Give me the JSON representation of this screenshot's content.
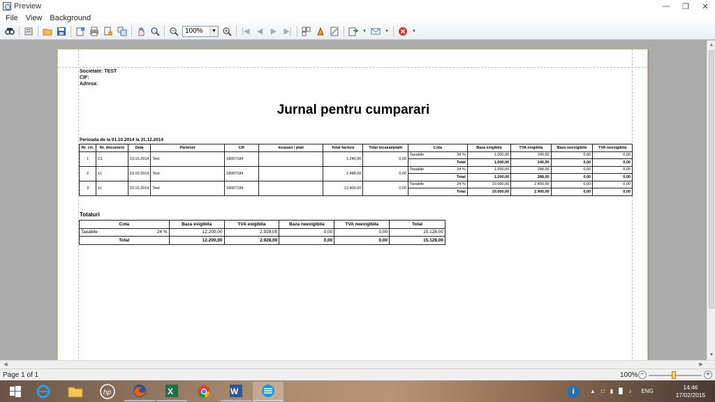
{
  "window": {
    "title": "Preview"
  },
  "menu": [
    "File",
    "View",
    "Background"
  ],
  "toolbar": {
    "zoom_value": "100%"
  },
  "report": {
    "societate": "Societate:  TEST",
    "cif": "CIF:",
    "adresa": "Adresa:",
    "title": "Jurnal pentru cumparari",
    "period": "Perioada de la 01.10.2014 la 31.12.2014",
    "headers": [
      "Nr. crt.",
      "Nr. document",
      "Data",
      "Partener",
      "CIF",
      "Incasari / plati",
      "Total factura",
      "Total incasat/platit",
      "Cota",
      "Baza exigibila",
      "TVA exigibila",
      "Baza neexigibila",
      "TVA neexigibila"
    ],
    "rows": [
      {
        "nr": "1",
        "doc": "C1",
        "data": "23.10.2014",
        "partener": "Test",
        "cif": "18007184",
        "incasari": "",
        "total_factura": "1.240,00",
        "total_incasat": "0,00",
        "cota_label": "Taxabile",
        "cota_pct": "24 %",
        "baza_ex": "1.000,00",
        "tva_ex": "240,00",
        "baza_neex": "0,00",
        "tva_neex": "0,00",
        "total_label": "Total",
        "t_baza_ex": "1.000,00",
        "t_tva_ex": "240,00",
        "t_baza_neex": "0,00",
        "t_tva_neex": "0,00"
      },
      {
        "nr": "2",
        "doc": "x1",
        "data": "23.10.2014",
        "partener": "Test",
        "cif": "18007184",
        "incasari": "",
        "total_factura": "1.488,00",
        "total_incasat": "0,00",
        "cota_label": "Taxabile",
        "cota_pct": "24 %",
        "baza_ex": "1.200,00",
        "tva_ex": "288,00",
        "baza_neex": "0,00",
        "tva_neex": "0,00",
        "total_label": "Total",
        "t_baza_ex": "1.200,00",
        "t_tva_ex": "288,00",
        "t_baza_neex": "0,00",
        "t_tva_neex": "0,00"
      },
      {
        "nr": "3",
        "doc": "z1",
        "data": "23.10.2014",
        "partener": "Test",
        "cif": "18007184",
        "incasari": "",
        "total_factura": "12.400,00",
        "total_incasat": "0,00",
        "cota_label": "Taxabile",
        "cota_pct": "24 %",
        "baza_ex": "10.000,00",
        "tva_ex": "2.400,00",
        "baza_neex": "0,00",
        "tva_neex": "0,00",
        "total_label": "Total",
        "t_baza_ex": "10.000,00",
        "t_tva_ex": "2.400,00",
        "t_baza_neex": "0,00",
        "t_tva_neex": "0,00"
      }
    ],
    "totaluri": {
      "title": "Totaluri",
      "headers": [
        "Cota",
        "Baza exigibila",
        "TVA exigibila",
        "Baza neexigibila",
        "TVA neexigibila",
        "Total"
      ],
      "row": {
        "label": "Taxabile",
        "pct": "24 %",
        "baza_ex": "12.200,00",
        "tva_ex": "2.928,00",
        "baza_neex": "0,00",
        "tva_neex": "0,00",
        "total": "15.128,00"
      },
      "total_row": {
        "label": "Total",
        "baza_ex": "12.200,00",
        "tva_ex": "2.928,00",
        "baza_neex": "0,00",
        "tva_neex": "0,00",
        "total": "15.128,00"
      }
    }
  },
  "status": {
    "page": "Page 1 of 1",
    "zoom": "100%"
  },
  "taskbar": {
    "lang": "ENG",
    "time": "14:46",
    "date": "17/02/2015"
  },
  "colors": {
    "accent": "#2a6fb0",
    "page_border": "#d8c48a"
  }
}
